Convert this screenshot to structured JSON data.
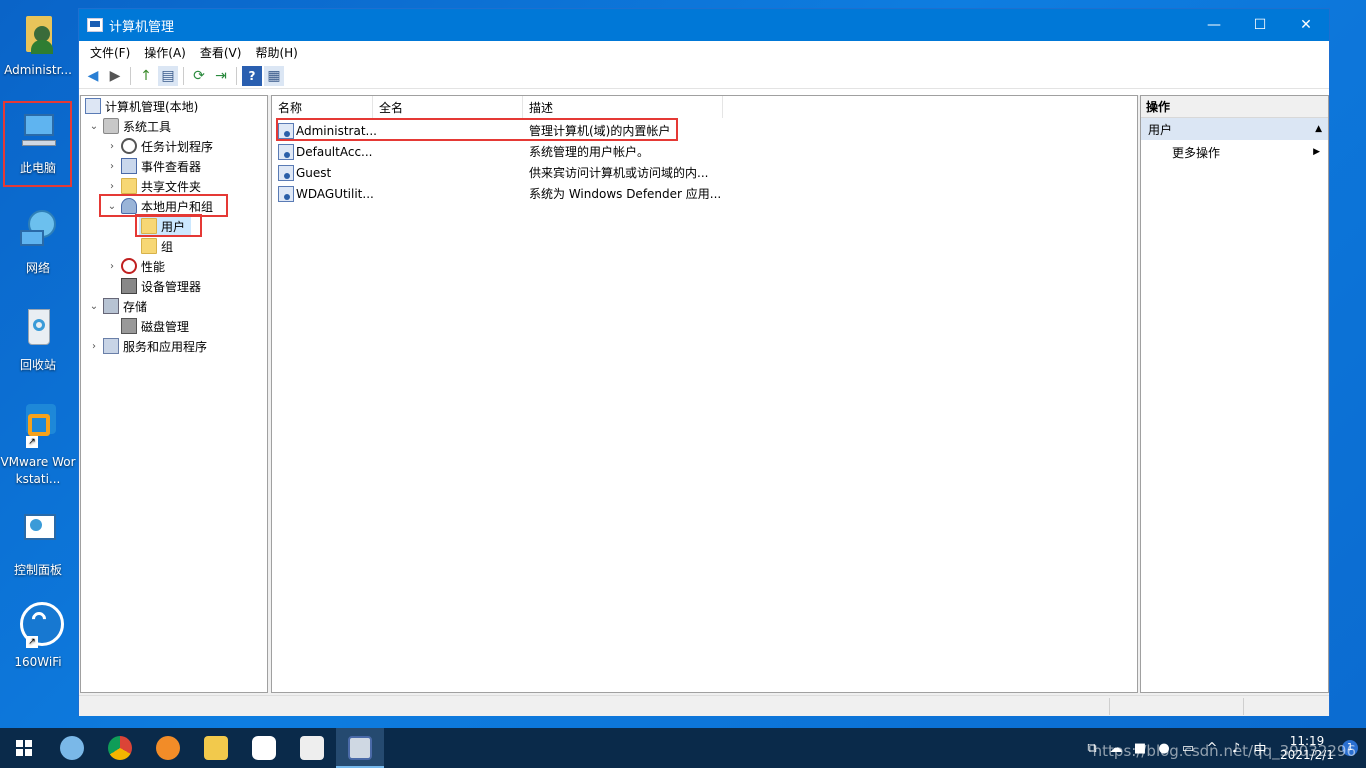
{
  "desktop": {
    "icons": [
      {
        "label": "Administr..."
      },
      {
        "label": "此电脑"
      },
      {
        "label": "网络"
      },
      {
        "label": "回收站"
      },
      {
        "label": "VMware Workstati..."
      },
      {
        "label": "控制面板"
      },
      {
        "label": "160WiFi"
      }
    ]
  },
  "window": {
    "title": "计算机管理",
    "controls": {
      "minimize": "—",
      "maximize": "☐",
      "close": "✕"
    }
  },
  "menu": [
    "文件(F)",
    "操作(A)",
    "查看(V)",
    "帮助(H)"
  ],
  "toolbar": {
    "back": "◀",
    "forward": "▶",
    "up": "↑",
    "showhide": "▤",
    "refresh": "⟳",
    "export": "⇥",
    "help": "?",
    "props": "▦"
  },
  "tree": {
    "root": "计算机管理(本地)",
    "system_tools": "系统工具",
    "task_scheduler": "任务计划程序",
    "event_viewer": "事件查看器",
    "shared_folders": "共享文件夹",
    "local_users_groups": "本地用户和组",
    "users": "用户",
    "groups": "组",
    "performance": "性能",
    "device_manager": "设备管理器",
    "storage": "存储",
    "disk_management": "磁盘管理",
    "services_apps": "服务和应用程序"
  },
  "list": {
    "columns": [
      "名称",
      "全名",
      "描述"
    ],
    "rows": [
      {
        "name": "Administrat...",
        "fullname": "",
        "desc": "管理计算机(域)的内置帐户"
      },
      {
        "name": "DefaultAcc...",
        "fullname": "",
        "desc": "系统管理的用户帐户。"
      },
      {
        "name": "Guest",
        "fullname": "",
        "desc": "供来宾访问计算机或访问域的内..."
      },
      {
        "name": "WDAGUtilit...",
        "fullname": "",
        "desc": "系统为 Windows Defender 应用..."
      }
    ]
  },
  "actions": {
    "header": "操作",
    "section": "用户",
    "more": "更多操作"
  },
  "taskbar": {
    "tray_ime": "中",
    "time": "11:19",
    "date": "2021/2/1",
    "watermark": "https://blog.csdn.net/qq_39032296",
    "notification_count": "1"
  },
  "colors": {
    "accent": "#0078d7",
    "highlight_box": "#e53935",
    "selected_bg": "#cce8ff"
  }
}
